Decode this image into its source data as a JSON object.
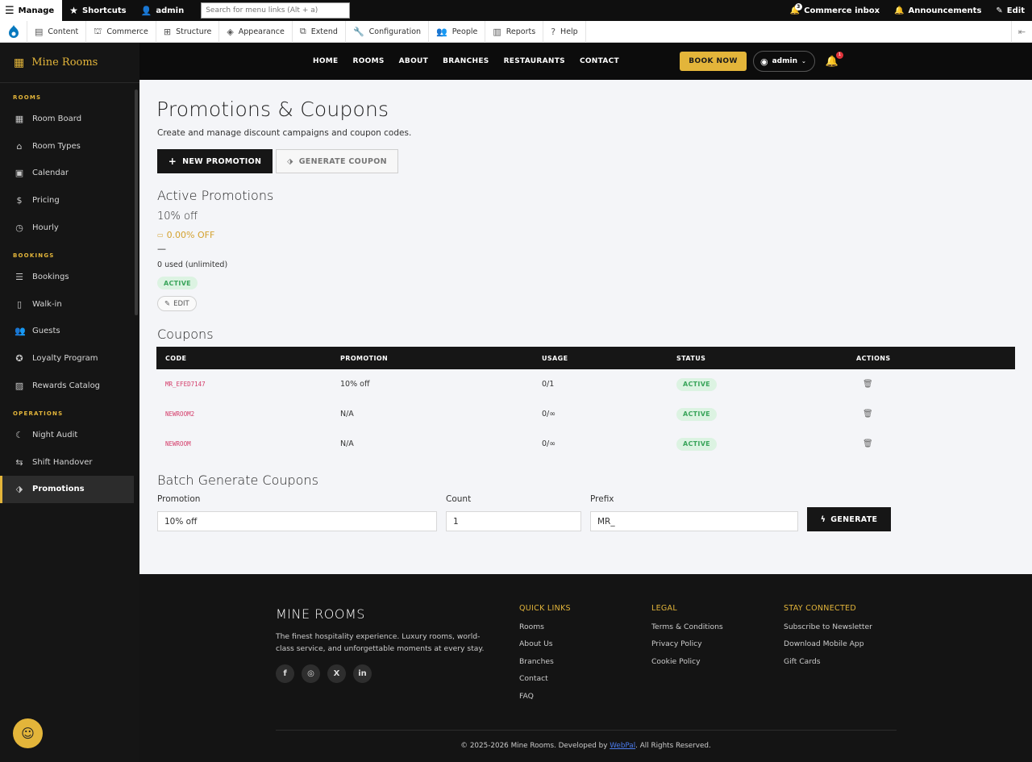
{
  "admin_bar": {
    "manage": "Manage",
    "shortcuts": "Shortcuts",
    "user": "admin",
    "search_placeholder": "Search for menu links (Alt + a)",
    "commerce_inbox": "Commerce inbox",
    "commerce_inbox_count": "3",
    "announcements": "Announcements",
    "edit": "Edit"
  },
  "admin_tray": {
    "items": [
      "Content",
      "Commerce",
      "Structure",
      "Appearance",
      "Extend",
      "Configuration",
      "People",
      "Reports",
      "Help"
    ]
  },
  "sidebar": {
    "brand": "Mine Rooms",
    "sections": [
      {
        "title": "ROOMS",
        "items": [
          {
            "label": "Room Board",
            "icon": "grid-icon"
          },
          {
            "label": "Room Types",
            "icon": "home-icon"
          },
          {
            "label": "Calendar",
            "icon": "calendar-icon"
          },
          {
            "label": "Pricing",
            "icon": "dollar-icon"
          },
          {
            "label": "Hourly",
            "icon": "clock-icon"
          }
        ]
      },
      {
        "title": "BOOKINGS",
        "items": [
          {
            "label": "Bookings",
            "icon": "document-icon"
          },
          {
            "label": "Walk-in",
            "icon": "door-icon"
          },
          {
            "label": "Guests",
            "icon": "users-icon"
          },
          {
            "label": "Loyalty Program",
            "icon": "award-icon"
          },
          {
            "label": "Rewards Catalog",
            "icon": "gift-icon"
          }
        ]
      },
      {
        "title": "OPERATIONS",
        "items": [
          {
            "label": "Night Audit",
            "icon": "night-icon"
          },
          {
            "label": "Shift Handover",
            "icon": "swap-icon"
          },
          {
            "label": "Promotions",
            "icon": "tag-icon",
            "active": true
          }
        ]
      }
    ]
  },
  "site_header": {
    "nav": [
      "HOME",
      "ROOMS",
      "ABOUT",
      "BRANCHES",
      "RESTAURANTS",
      "CONTACT"
    ],
    "book_now": "BOOK NOW",
    "user": "admin",
    "notifications": "1"
  },
  "page": {
    "title": "Promotions & Coupons",
    "subtitle": "Create and manage discount campaigns and coupon codes.",
    "new_promotion": "NEW PROMOTION",
    "generate_coupon": "GENERATE COUPON"
  },
  "active_promotions": {
    "heading": "Active Promotions",
    "name": "10% off",
    "discount": "0.00% OFF",
    "dash": "—",
    "usage": "0 used (unlimited)",
    "status": "ACTIVE",
    "edit": "EDIT"
  },
  "coupons": {
    "heading": "Coupons",
    "columns": [
      "CODE",
      "PROMOTION",
      "USAGE",
      "STATUS",
      "ACTIONS"
    ],
    "rows": [
      {
        "code": "MR_EFED7147",
        "promotion": "10% off",
        "usage": "0/1",
        "status": "ACTIVE"
      },
      {
        "code": "NEWROOM2",
        "promotion": "N/A",
        "usage": "0/∞",
        "status": "ACTIVE"
      },
      {
        "code": "NEWROOM",
        "promotion": "N/A",
        "usage": "0/∞",
        "status": "ACTIVE"
      }
    ]
  },
  "batch": {
    "heading": "Batch Generate Coupons",
    "promotion_label": "Promotion",
    "promotion_value": "10% off",
    "count_label": "Count",
    "count_value": "1",
    "prefix_label": "Prefix",
    "prefix_value": "MR_",
    "generate": "GENERATE"
  },
  "footer": {
    "brand": "MINE ROOMS",
    "tagline": "The finest hospitality experience. Luxury rooms, world-class service, and unforgettable moments at every stay.",
    "quick_links": {
      "title": "QUICK LINKS",
      "items": [
        "Rooms",
        "About Us",
        "Branches",
        "Contact",
        "FAQ"
      ]
    },
    "legal": {
      "title": "LEGAL",
      "items": [
        "Terms & Conditions",
        "Privacy Policy",
        "Cookie Policy"
      ]
    },
    "stay_connected": {
      "title": "STAY CONNECTED",
      "items": [
        "Subscribe to Newsletter",
        "Download Mobile App",
        "Gift Cards"
      ]
    },
    "copyright_pre": "© 2025-2026 Mine Rooms. Developed by ",
    "copyright_link": "WebPal",
    "copyright_post": ". All Rights Reserved."
  },
  "colors": {
    "accent": "#e3b53a",
    "dark": "#161616",
    "active_badge": "#3aa55b",
    "code": "#d43a68"
  }
}
